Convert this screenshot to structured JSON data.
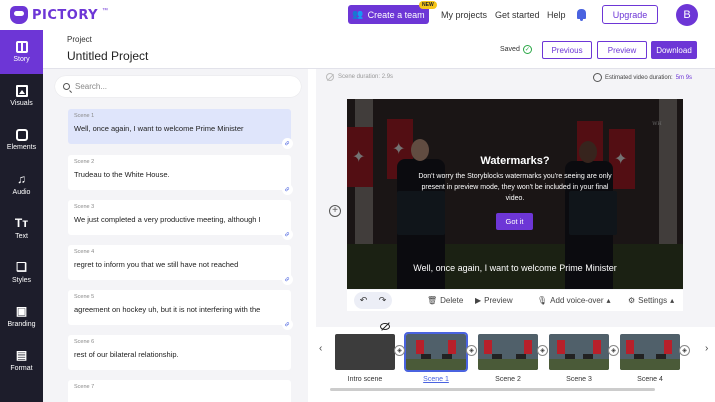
{
  "app": {
    "brand": "PICTORY",
    "brand_tm": "™"
  },
  "topnav": {
    "create_team": "Create a team",
    "new_badge": "NEW",
    "my_projects": "My projects",
    "get_started": "Get started",
    "help": "Help",
    "upgrade": "Upgrade",
    "avatar_initial": "B"
  },
  "sidebar": {
    "items": [
      {
        "label": "Story",
        "icon": "story-icon",
        "active": true
      },
      {
        "label": "Visuals",
        "icon": "image-icon"
      },
      {
        "label": "Elements",
        "icon": "elements-icon"
      },
      {
        "label": "Audio",
        "icon": "music-icon"
      },
      {
        "label": "Text",
        "icon": "text-icon"
      },
      {
        "label": "Styles",
        "icon": "styles-icon"
      },
      {
        "label": "Branding",
        "icon": "briefcase-icon"
      },
      {
        "label": "Format",
        "icon": "format-icon"
      }
    ]
  },
  "project": {
    "label": "Project",
    "title": "Untitled Project",
    "saved": "Saved",
    "previous": "Previous",
    "preview": "Preview",
    "download": "Download"
  },
  "scenes_panel": {
    "search_placeholder": "Search...",
    "scenes": [
      {
        "number": "Scene 1",
        "text": "Well, once again, I want to welcome Prime Minister"
      },
      {
        "number": "Scene 2",
        "text": "Trudeau to the White House."
      },
      {
        "number": "Scene 3",
        "text": "We just completed a very productive meeting, although I"
      },
      {
        "number": "Scene 4",
        "text": "regret to inform you that we still have not reached"
      },
      {
        "number": "Scene 5",
        "text": "agreement on hockey uh, but it is not interfering with the"
      },
      {
        "number": "Scene 6",
        "text": "rest of our bilateral relationship."
      },
      {
        "number": "Scene 7",
        "text": ""
      }
    ]
  },
  "editor": {
    "scene_duration": "Scene duration: 2.9s",
    "estimated_label": "Estimated video duration:",
    "estimated_value": "5m 9s",
    "watermark_title": "Watermarks?",
    "watermark_body": "Don't worry the Storyblocks watermarks you're seeing are only present in preview mode, they won't be included in your final video.",
    "got_it": "Got it",
    "caption": "Well, once again, I want to welcome Prime Minister",
    "wh_logo": "WH"
  },
  "toolbar": {
    "undo": "↶",
    "redo": "↷",
    "delete": "Delete",
    "preview": "Preview",
    "voice_over": "Add voice-over",
    "settings": "Settings"
  },
  "timeline": {
    "thumbnails": [
      {
        "label": "Intro scene"
      },
      {
        "label": "Scene 1",
        "selected": true
      },
      {
        "label": "Scene 2"
      },
      {
        "label": "Scene 3"
      },
      {
        "label": "Scene 4"
      }
    ]
  },
  "colors": {
    "accent": "#6d36d6",
    "sidebar_bg": "#1d1d2b",
    "link_blue": "#4a63e0"
  }
}
